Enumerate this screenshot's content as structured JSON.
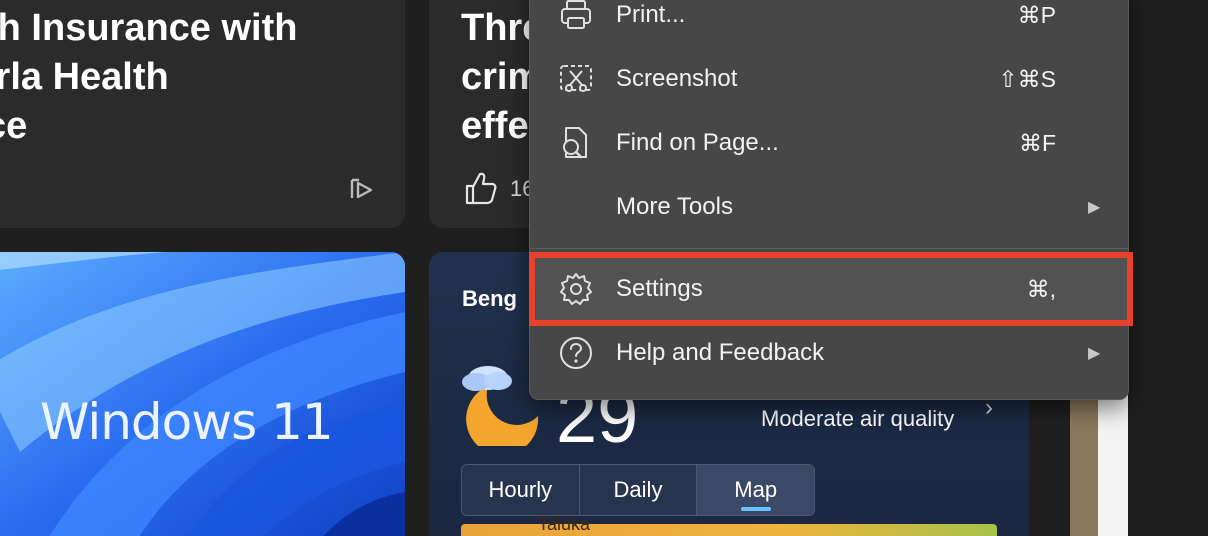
{
  "news": {
    "card1": {
      "headline_lines": [
        "th Insurance with",
        "irla Health",
        "ce"
      ]
    },
    "card2": {
      "headline_lines": [
        "Thre",
        "crim",
        "effe"
      ],
      "like_count": "16"
    }
  },
  "windows_card": {
    "text": "Windows 11"
  },
  "weather": {
    "city": "Beng",
    "temperature": "29",
    "air_quality": "Moderate air quality",
    "air_chevron": "›",
    "tabs": [
      "Hourly",
      "Daily",
      "Map"
    ],
    "active_tab": "Map",
    "map_label": "Taluka"
  },
  "menu": {
    "items": [
      {
        "label": "Print...",
        "shortcut": "⌘P",
        "icon": "printer-icon"
      },
      {
        "label": "Screenshot",
        "shortcut": "⇧⌘S",
        "icon": "screenshot-icon"
      },
      {
        "label": "Find on Page...",
        "shortcut": "⌘F",
        "icon": "find-on-page-icon"
      },
      {
        "label": "More Tools",
        "shortcut": "",
        "icon": "",
        "submenu_arrow": "▶"
      },
      {
        "label": "Settings",
        "shortcut": "⌘,",
        "icon": "gear-icon"
      },
      {
        "label": "Help and Feedback",
        "shortcut": "",
        "icon": "help-icon",
        "submenu_arrow": "▶"
      }
    ],
    "highlighted_item": "Settings",
    "highlight_color": "#e8412c"
  }
}
